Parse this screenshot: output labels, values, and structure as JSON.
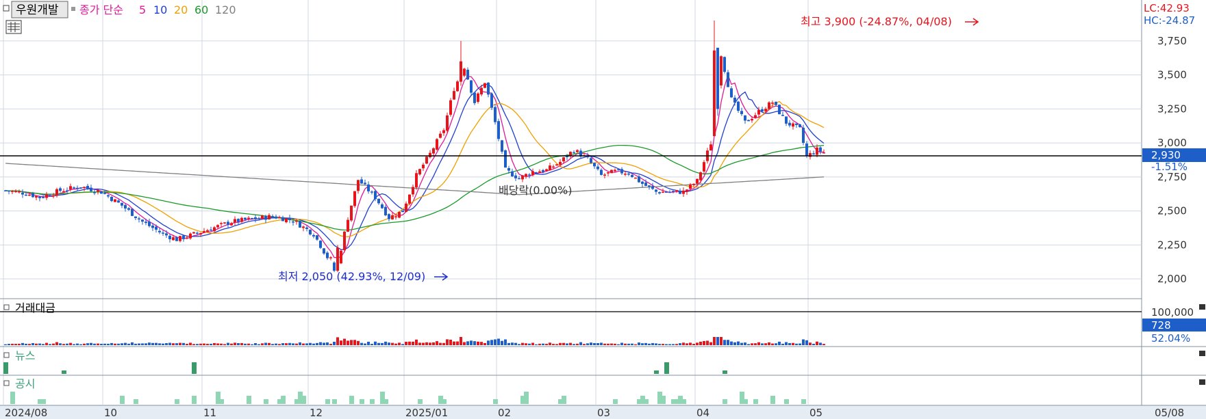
{
  "header": {
    "stock_name": "우원개발",
    "ma_label": "종가 단순",
    "ma_periods": [
      "5",
      "10",
      "20",
      "60",
      "120"
    ],
    "ma_colors": [
      "#e0189a",
      "#1f3fd0",
      "#f0a000",
      "#1a9a2a",
      "#808080"
    ]
  },
  "right_panel": {
    "lc": "LC:42.93",
    "hc": "HC:-24.87",
    "price_tag": "2,930",
    "change_pct": "-1.51%",
    "vol_max": "100,000",
    "vol_tag": "728",
    "vol_pct": "52.04%",
    "corner_date": "05/08"
  },
  "annotations": {
    "high": "최고 3,900 (-24.87%, 04/08)",
    "low": "최저 2,050 (42.93%, 12/09)",
    "dividend": "배당락(0.00%)"
  },
  "panels": {
    "volume": "거래대금",
    "news": "뉴스",
    "disclosure": "공시"
  },
  "colors": {
    "up": "#e8141c",
    "down": "#1e5ec8",
    "grid": "#d0d8e0",
    "panel_bg": "#e8eef6"
  },
  "chart_data": {
    "type": "candlestick",
    "title": "우원개발",
    "current_price": 2930,
    "y_ticks": [
      2000,
      2250,
      2500,
      2750,
      3000,
      3250,
      3500,
      3750
    ],
    "ylim": [
      1950,
      3850
    ],
    "x_labels": [
      "2024/08",
      "10",
      "11",
      "12",
      "2025/01",
      "02",
      "03",
      "04",
      "05"
    ],
    "month_ticks": [
      {
        "label": "2024/08",
        "idx": 0
      },
      {
        "label": "10",
        "idx": 29
      },
      {
        "label": "11",
        "idx": 58
      },
      {
        "label": "12",
        "idx": 89
      },
      {
        "label": "2025/01",
        "idx": 117
      },
      {
        "label": "02",
        "idx": 144
      },
      {
        "label": "03",
        "idx": 173
      },
      {
        "label": "04",
        "idx": 202
      },
      {
        "label": "05",
        "idx": 235
      }
    ],
    "anchors": [
      [
        0,
        2650
      ],
      [
        6,
        2630
      ],
      [
        10,
        2600
      ],
      [
        16,
        2650
      ],
      [
        22,
        2680
      ],
      [
        28,
        2640
      ],
      [
        34,
        2540
      ],
      [
        40,
        2420
      ],
      [
        46,
        2330
      ],
      [
        50,
        2290
      ],
      [
        54,
        2320
      ],
      [
        60,
        2370
      ],
      [
        66,
        2420
      ],
      [
        72,
        2440
      ],
      [
        78,
        2460
      ],
      [
        84,
        2430
      ],
      [
        90,
        2330
      ],
      [
        94,
        2160
      ],
      [
        97,
        2110
      ],
      [
        100,
        2450
      ],
      [
        103,
        2730
      ],
      [
        108,
        2600
      ],
      [
        112,
        2450
      ],
      [
        116,
        2500
      ],
      [
        120,
        2760
      ],
      [
        124,
        2920
      ],
      [
        128,
        3100
      ],
      [
        131,
        3400
      ],
      [
        134,
        3560
      ],
      [
        137,
        3300
      ],
      [
        140,
        3450
      ],
      [
        143,
        3150
      ],
      [
        146,
        2800
      ],
      [
        150,
        2740
      ],
      [
        154,
        2790
      ],
      [
        158,
        2800
      ],
      [
        162,
        2860
      ],
      [
        166,
        2950
      ],
      [
        170,
        2880
      ],
      [
        174,
        2760
      ],
      [
        178,
        2790
      ],
      [
        182,
        2780
      ],
      [
        186,
        2700
      ],
      [
        190,
        2640
      ],
      [
        194,
        2640
      ],
      [
        198,
        2640
      ],
      [
        202,
        2720
      ],
      [
        206,
        3000
      ],
      [
        209,
        3650
      ],
      [
        212,
        3320
      ],
      [
        216,
        3150
      ],
      [
        220,
        3230
      ],
      [
        224,
        3300
      ],
      [
        228,
        3150
      ],
      [
        232,
        3100
      ],
      [
        234,
        2900
      ],
      [
        237,
        2950
      ],
      [
        239,
        2930
      ]
    ],
    "special_candles": [
      {
        "idx": 96,
        "open": 2120,
        "high": 2130,
        "low": 2050,
        "close": 2060
      },
      {
        "idx": 97,
        "open": 2060,
        "high": 2250,
        "low": 2050,
        "close": 2230
      },
      {
        "idx": 133,
        "open": 3450,
        "high": 3750,
        "low": 3420,
        "close": 3600
      },
      {
        "idx": 207,
        "open": 3050,
        "high": 3900,
        "low": 3050,
        "close": 3680
      },
      {
        "idx": 208,
        "open": 3700,
        "high": 3700,
        "low": 3200,
        "close": 3250
      }
    ],
    "ma120_end": 2750,
    "volume_max": 100000,
    "news_events": [
      0,
      17,
      55,
      190,
      193,
      210
    ],
    "disclosure_events": [
      2,
      10,
      11,
      34,
      38,
      50,
      55,
      62,
      63,
      71,
      76,
      80,
      81,
      85,
      86,
      87,
      94,
      96,
      101,
      104,
      107,
      110,
      111,
      121,
      127,
      128,
      143,
      151,
      152,
      162,
      163,
      178,
      185,
      186,
      187,
      191,
      192,
      195,
      196,
      197,
      198,
      210,
      215,
      216,
      219,
      224,
      228,
      233
    ]
  }
}
